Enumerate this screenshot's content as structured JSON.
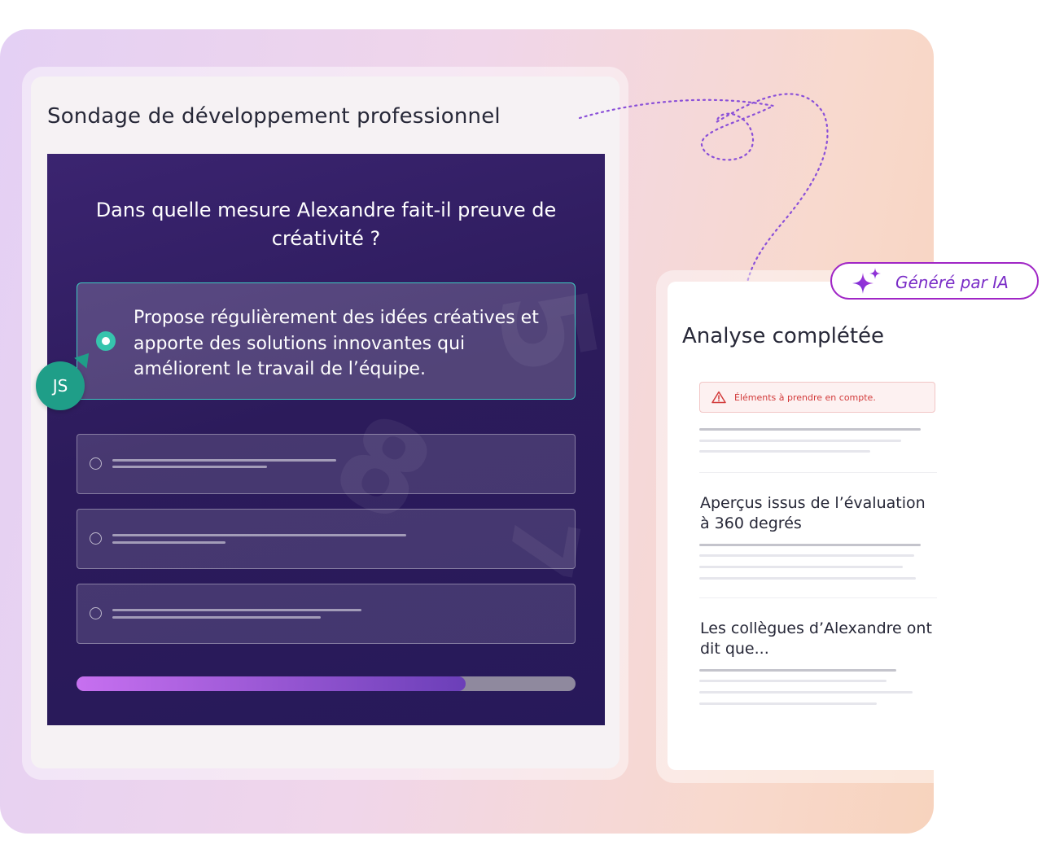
{
  "survey": {
    "title": "Sondage de développement professionnel",
    "question": "Dans quelle mesure Alexandre fait-il preuve de créativité ?",
    "selected_option": "Propose régulièrement des idées créatives et apporte des solutions innovantes qui améliorent le travail de l’équipe.",
    "respondent_initials": "JS",
    "progress": 0.78
  },
  "ai_badge": {
    "label": "Généré par IA",
    "icon": "sparkles-icon"
  },
  "analysis": {
    "title": "Analyse complétée",
    "alert": "Éléments à prendre en compte.",
    "sections": [
      {
        "title": "Aperçus issus de l’évaluation à 360 degrés"
      },
      {
        "title": "Les collègues d’Alexandre ont dit que..."
      }
    ]
  },
  "colors": {
    "accent": "#a026c6",
    "selected_border": "#3ec9c0",
    "avatar": "#1f9e88",
    "alert_text": "#d23a3a",
    "panel_bg": "#2c1b5b"
  }
}
